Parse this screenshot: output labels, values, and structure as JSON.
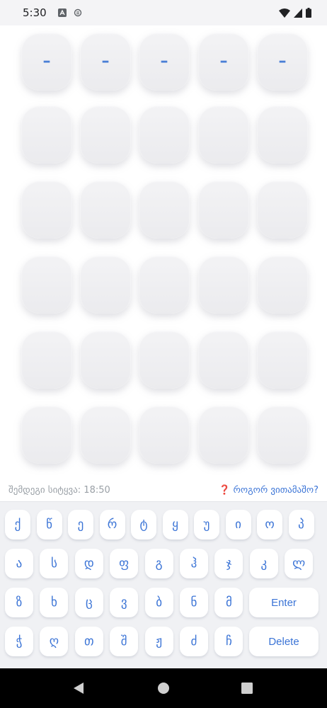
{
  "status": {
    "time": "5:30"
  },
  "board": {
    "rows": 6,
    "cols": 5,
    "first_row": [
      "–",
      "–",
      "–",
      "–",
      "–"
    ]
  },
  "info": {
    "next_word": "შემდეგი სიტყვა: 18:50",
    "how_to_play": "❓ როგორ ვითამაშო?"
  },
  "keyboard": {
    "rows": [
      [
        "ქ",
        "წ",
        "ე",
        "რ",
        "ტ",
        "ყ",
        "უ",
        "ი",
        "ო",
        "პ"
      ],
      [
        "ა",
        "ს",
        "დ",
        "ფ",
        "გ",
        "ჰ",
        "ჯ",
        "კ",
        "ლ"
      ],
      [
        "ზ",
        "ხ",
        "ც",
        "ვ",
        "ბ",
        "ნ",
        "მ",
        "Enter"
      ],
      [
        "ჭ",
        "ღ",
        "თ",
        "შ",
        "ჟ",
        "ძ",
        "ჩ",
        "Delete"
      ]
    ]
  },
  "colors": {
    "accent": "#3b74d6",
    "tile": "#efeff2",
    "keyboard_bg": "#f0f1f4"
  }
}
